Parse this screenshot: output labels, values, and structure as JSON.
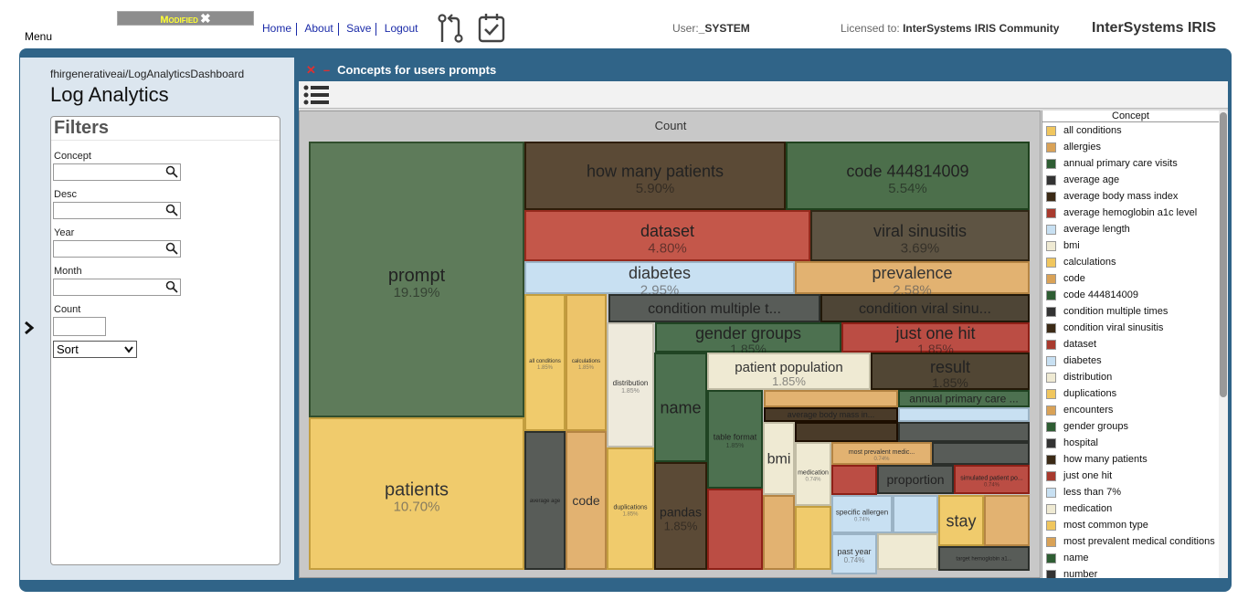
{
  "header": {
    "menu_label": "Menu",
    "modified_label": "Modified",
    "links": [
      "Home",
      "About",
      "Save",
      "Logout"
    ],
    "user_label": "User:",
    "user_value": "_SYSTEM",
    "licensed_label": "Licensed to:",
    "licensed_value": "InterSystems IRIS Community",
    "brand": "InterSystems IRIS",
    "icons": [
      "source-control-icon",
      "task-checklist-icon"
    ]
  },
  "dashboard": {
    "path": "fhirgenerativeai/LogAnalyticsDashboard",
    "title": "Log Analytics"
  },
  "filters": {
    "title": "Filters",
    "fields": [
      "Concept",
      "Desc",
      "Year",
      "Month"
    ],
    "count_label": "Count",
    "sort_label": "Sort"
  },
  "widget": {
    "title": "Concepts for users prompts",
    "toolbar_icon": "list-menu-icon"
  },
  "chart_data": {
    "type": "treemap",
    "title": "Count",
    "legend_title": "Concept",
    "items": [
      {
        "label": "prompt",
        "value": "19.19%",
        "color": "#5e7b5a"
      },
      {
        "label": "patients",
        "value": "10.70%",
        "color": "#f0cb6c"
      },
      {
        "label": "how many patients",
        "value": "5.90%",
        "color": "#5b4a36"
      },
      {
        "label": "code 444814009",
        "value": "5.54%",
        "color": "#4c6f4b"
      },
      {
        "label": "dataset",
        "value": "4.80%",
        "color": "#c4574a"
      },
      {
        "label": "viral sinusitis",
        "value": "3.69%",
        "color": "#5e5443"
      },
      {
        "label": "diabetes",
        "value": "2.95%",
        "color": "#c8e0f2"
      },
      {
        "label": "prevalence",
        "value": "2.58%",
        "color": "#e2b271"
      },
      {
        "label": "condition multiple t...",
        "value": "",
        "color": "#585c58"
      },
      {
        "label": "condition viral sinu...",
        "value": "",
        "color": "#4e4536"
      },
      {
        "label": "gender groups",
        "value": "1.85%",
        "color": "#4d7150"
      },
      {
        "label": "just one hit",
        "value": "1.85%",
        "color": "#bb4d44"
      },
      {
        "label": "patient population",
        "value": "1.85%",
        "color": "#efead3"
      },
      {
        "label": "result",
        "value": "1.85%",
        "color": "#514634"
      },
      {
        "label": "all conditions",
        "value": "1.85%",
        "color": "#f0cb6c"
      },
      {
        "label": "calculations",
        "value": "1.85%",
        "color": "#edc46a"
      },
      {
        "label": "distribution",
        "value": "1.85%",
        "color": "#eeeadc"
      },
      {
        "label": "name",
        "value": "1.85%",
        "color": "#4d7150"
      },
      {
        "label": "annual primary care ...",
        "value": "",
        "color": "#4d7150"
      },
      {
        "label": "average body mass in...",
        "value": "",
        "color": "#4a3b29"
      },
      {
        "label": "table format",
        "value": "1.85%",
        "color": "#4d7150"
      },
      {
        "label": "bmi",
        "value": "",
        "color": "#efead3"
      },
      {
        "label": "medication",
        "value": "0.74%",
        "color": "#efead3"
      },
      {
        "label": "most prevalent medic...",
        "value": "0.74%",
        "color": "#e2b271"
      },
      {
        "label": "proportion",
        "value": "",
        "color": "#585c58"
      },
      {
        "label": "simulated patient po...",
        "value": "0.74%",
        "color": "#bb4d44"
      },
      {
        "label": "specific allergen",
        "value": "0.74%",
        "color": "#c8e0f2"
      },
      {
        "label": "stay",
        "value": "",
        "color": "#f0cb6c"
      },
      {
        "label": "past year",
        "value": "0.74%",
        "color": "#c8e0f2"
      },
      {
        "label": "target hemoglobin a1...",
        "value": "",
        "color": "#585c58"
      },
      {
        "label": "average age",
        "value": "",
        "color": "#585c58"
      },
      {
        "label": "code",
        "value": "",
        "color": "#e2b271"
      },
      {
        "label": "duplications",
        "value": "1.85%",
        "color": "#f0cb6c"
      },
      {
        "label": "pandas",
        "value": "1.85%",
        "color": "#5b4a36"
      }
    ],
    "legend": [
      {
        "label": "all conditions",
        "color": "#f0c65e"
      },
      {
        "label": "allergies",
        "color": "#d9a257"
      },
      {
        "label": "annual primary care visits",
        "color": "#2e5d33"
      },
      {
        "label": "average age",
        "color": "#333333"
      },
      {
        "label": "average body mass index",
        "color": "#3b2a16"
      },
      {
        "label": "average hemoglobin a1c level",
        "color": "#a83a2e"
      },
      {
        "label": "average length",
        "color": "#c8e0f2"
      },
      {
        "label": "bmi",
        "color": "#efead3"
      },
      {
        "label": "calculations",
        "color": "#f0c65e"
      },
      {
        "label": "code",
        "color": "#d9a257"
      },
      {
        "label": "code 444814009",
        "color": "#2e5d33"
      },
      {
        "label": "condition multiple times",
        "color": "#333333"
      },
      {
        "label": "condition viral sinusitis",
        "color": "#3b2a16"
      },
      {
        "label": "dataset",
        "color": "#a83a2e"
      },
      {
        "label": "diabetes",
        "color": "#c8e0f2"
      },
      {
        "label": "distribution",
        "color": "#efead3"
      },
      {
        "label": "duplications",
        "color": "#f0c65e"
      },
      {
        "label": "encounters",
        "color": "#d9a257"
      },
      {
        "label": "gender groups",
        "color": "#2e5d33"
      },
      {
        "label": "hospital",
        "color": "#333333"
      },
      {
        "label": "how many patients",
        "color": "#3b2a16"
      },
      {
        "label": "just one hit",
        "color": "#a83a2e"
      },
      {
        "label": "less than 7%",
        "color": "#c8e0f2"
      },
      {
        "label": "medication",
        "color": "#efead3"
      },
      {
        "label": "most common type",
        "color": "#f0c65e"
      },
      {
        "label": "most prevalent medical conditions",
        "color": "#d9a257"
      },
      {
        "label": "name",
        "color": "#2e5d33"
      },
      {
        "label": "number",
        "color": "#333333"
      }
    ]
  }
}
